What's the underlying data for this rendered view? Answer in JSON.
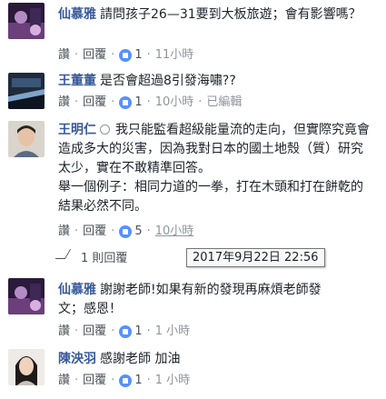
{
  "comments": [
    {
      "author": "仙慕雅",
      "text": "請問孩子26—31要到大板旅遊；會有影響嗎？",
      "actions": {
        "like": "讚",
        "reply": "回覆",
        "likes": "1",
        "time": "11小時"
      }
    },
    {
      "author": "王董董",
      "text": "是否會超過8引發海嘯??",
      "actions": {
        "like": "讚",
        "reply": "回覆",
        "likes": "1",
        "time": "10小時",
        "edited": "已編輯"
      }
    },
    {
      "author": "王明仁",
      "text": "我只能監看超級能量流的走向，但實際究竟會造成多大的災害，因為我對日本的國土地殼（質）研究太少，實在不敢精準回答。",
      "text2": "舉一個例子：相同力道的一拳，打在木頭和打在餅乾的結果必然不同。",
      "actions": {
        "like": "讚",
        "reply": "回覆",
        "likes": "5",
        "time": "10小時"
      }
    },
    {
      "author": "仙慕雅",
      "text": "謝謝老師!如果有新的發現再麻煩老師發文；感恩！",
      "actions": {
        "like": "讚",
        "reply": "回覆",
        "likes": "1",
        "time": "1 小時"
      }
    },
    {
      "author": "陳泱羽",
      "text": "感謝老師 加油",
      "actions": {
        "like": "讚",
        "reply": "回覆",
        "likes": "1",
        "time": "1 小時"
      }
    }
  ],
  "replies_link": "1 則回覆",
  "tooltip": "2017年9月22日 22:56",
  "colors": {
    "author": "#365899",
    "like_badge": "#5890ff",
    "background": "#ffffff"
  }
}
